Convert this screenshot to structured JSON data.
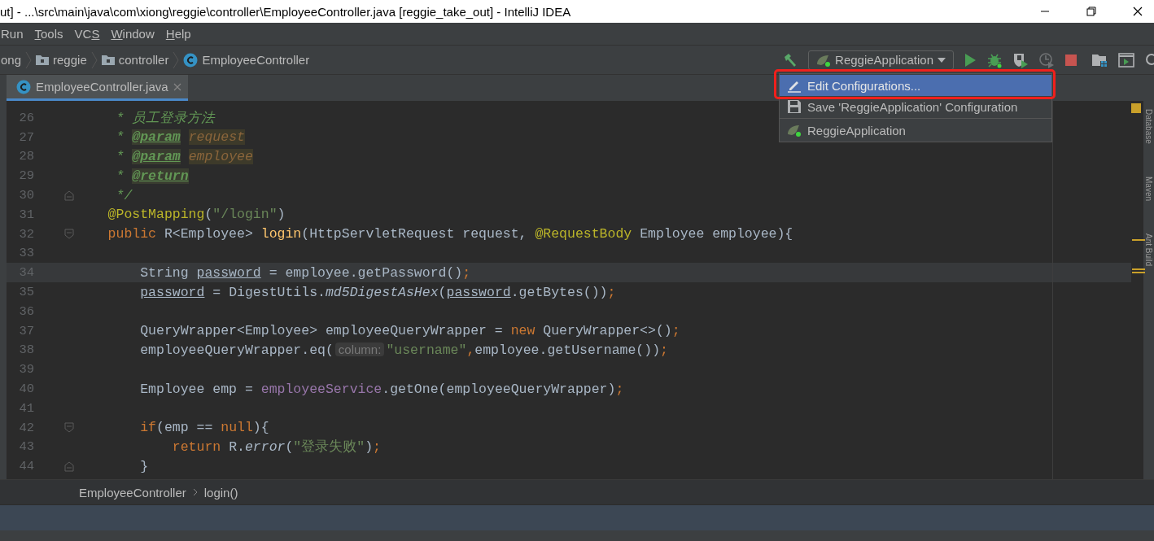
{
  "window": {
    "title": "ut] - ...\\src\\main\\java\\com\\xiong\\reggie\\controller\\EmployeeController.java [reggie_take_out] - IntelliJ IDEA"
  },
  "menu": [
    {
      "parts": [
        {
          "text": "Run",
          "underlined": false
        }
      ]
    },
    {
      "parts": [
        {
          "text": "T",
          "underlined": true
        },
        {
          "text": "ools",
          "underlined": false
        }
      ]
    },
    {
      "parts": [
        {
          "text": "VC",
          "underlined": false
        },
        {
          "text": "S",
          "underlined": true
        }
      ]
    },
    {
      "parts": [
        {
          "text": "W",
          "underlined": true
        },
        {
          "text": "indow",
          "underlined": false
        }
      ]
    },
    {
      "parts": [
        {
          "text": "H",
          "underlined": true
        },
        {
          "text": "elp",
          "underlined": false
        }
      ]
    }
  ],
  "breadcrumbs": [
    {
      "label": "ong",
      "kind": "text"
    },
    {
      "label": "reggie",
      "kind": "folder"
    },
    {
      "label": "controller",
      "kind": "folder"
    },
    {
      "label": "EmployeeController",
      "kind": "class"
    }
  ],
  "run_config": {
    "label": "ReggieApplication"
  },
  "toolbar": [
    {
      "kind": "run",
      "disabled": false
    },
    {
      "kind": "debug",
      "disabled": false
    },
    {
      "kind": "coverage",
      "disabled": false
    },
    {
      "kind": "profile",
      "disabled": true
    },
    {
      "kind": "stop",
      "disabled": false
    },
    {
      "kind": "structure",
      "disabled": false
    },
    {
      "kind": "terminal",
      "disabled": false
    },
    {
      "kind": "search",
      "disabled": false
    }
  ],
  "dropdown": [
    {
      "label": "Edit Configurations...",
      "kind": "edit",
      "selected": true
    },
    {
      "label": "Save 'ReggieApplication' Configuration",
      "kind": "save",
      "selected": false
    },
    {
      "label": "ReggieApplication",
      "kind": "app",
      "selected": false
    }
  ],
  "tabs": [
    {
      "label": "EmployeeController.java",
      "selected": true
    }
  ],
  "editor": {
    "lines": [
      {
        "number": "26",
        "current": false,
        "kind": "doc",
        "tokens": [
          {
            "kind": "doc",
            "text": "* 员工登录方法"
          }
        ]
      },
      {
        "number": "27",
        "current": false,
        "kind": "doc",
        "tokens": [
          {
            "kind": "doc",
            "text": "* "
          },
          {
            "kind": "doctag",
            "text": "@param"
          },
          {
            "kind": "docparam",
            "text": "request"
          }
        ]
      },
      {
        "number": "28",
        "current": false,
        "kind": "doc",
        "tokens": [
          {
            "kind": "doc",
            "text": "* "
          },
          {
            "kind": "doctag",
            "text": "@param"
          },
          {
            "kind": "docparam",
            "text": "employee"
          }
        ]
      },
      {
        "number": "29",
        "current": false,
        "kind": "doc",
        "tokens": [
          {
            "kind": "doc",
            "text": "* "
          },
          {
            "kind": "doctag",
            "text": "@return"
          }
        ]
      },
      {
        "number": "30",
        "current": false,
        "kind": "doc_fold_end",
        "tokens": [
          {
            "kind": "doc",
            "text": "*/"
          }
        ]
      },
      {
        "number": "31",
        "current": false,
        "kind": "member",
        "tokens": [
          {
            "kind": "annotation",
            "text": "@PostMapping"
          },
          {
            "kind": "plain",
            "text": "("
          },
          {
            "kind": "string",
            "text": "\"/login\""
          },
          {
            "kind": "plain",
            "text": ")"
          }
        ]
      },
      {
        "number": "32",
        "current": false,
        "kind": "member_fold_start",
        "tokens": [
          {
            "kind": "keyword",
            "text": "public "
          },
          {
            "kind": "plain",
            "text": "R<Employee> "
          },
          {
            "kind": "decl",
            "text": "login"
          },
          {
            "kind": "plain",
            "text": "(HttpServletRequest request, "
          },
          {
            "kind": "annotation",
            "text": "@RequestBody"
          },
          {
            "kind": "plain",
            "text": " Employee employee){"
          }
        ]
      },
      {
        "number": "33",
        "current": false,
        "kind": "blank"
      },
      {
        "number": "34",
        "current": true,
        "kind": "body",
        "tokens": [
          {
            "kind": "plain",
            "text": "String "
          },
          {
            "kind": "underline",
            "text": "password"
          },
          {
            "kind": "plain",
            "text": " = employee.getPassword()"
          },
          {
            "kind": "keyword",
            "text": ";"
          }
        ]
      },
      {
        "number": "35",
        "current": false,
        "kind": "body",
        "tokens": [
          {
            "kind": "underline",
            "text": "password"
          },
          {
            "kind": "plain",
            "text": " = DigestUtils."
          },
          {
            "kind": "italic",
            "text": "md5DigestAsHex"
          },
          {
            "kind": "plain",
            "text": "("
          },
          {
            "kind": "underline",
            "text": "password"
          },
          {
            "kind": "plain",
            "text": ".getBytes())"
          },
          {
            "kind": "keyword",
            "text": ";"
          }
        ]
      },
      {
        "number": "36",
        "current": false,
        "kind": "blank"
      },
      {
        "number": "37",
        "current": false,
        "kind": "body",
        "tokens": [
          {
            "kind": "plain",
            "text": "QueryWrapper<Employee> employeeQueryWrapper = "
          },
          {
            "kind": "keyword",
            "text": "new "
          },
          {
            "kind": "plain",
            "text": "QueryWrapper<>()"
          },
          {
            "kind": "keyword",
            "text": ";"
          }
        ]
      },
      {
        "number": "38",
        "current": false,
        "kind": "body",
        "tokens": [
          {
            "kind": "plain",
            "text": "employeeQueryWrapper.eq("
          },
          {
            "kind": "hint",
            "text": "column:"
          },
          {
            "kind": "string",
            "text": "\"username\""
          },
          {
            "kind": "keyword",
            "text": ","
          },
          {
            "kind": "plain",
            "text": "employee.getUsername())"
          },
          {
            "kind": "keyword",
            "text": ";"
          }
        ]
      },
      {
        "number": "39",
        "current": false,
        "kind": "blank"
      },
      {
        "number": "40",
        "current": false,
        "kind": "body",
        "tokens": [
          {
            "kind": "plain",
            "text": "Employee emp = "
          },
          {
            "kind": "field",
            "text": "employeeService"
          },
          {
            "kind": "plain",
            "text": ".getOne(employeeQueryWrapper)"
          },
          {
            "kind": "keyword",
            "text": ";"
          }
        ]
      },
      {
        "number": "41",
        "current": false,
        "kind": "blank"
      },
      {
        "number": "42",
        "current": false,
        "kind": "body_fold_start",
        "tokens": [
          {
            "kind": "keyword",
            "text": "if"
          },
          {
            "kind": "plain",
            "text": "(emp == "
          },
          {
            "kind": "keyword",
            "text": "null"
          },
          {
            "kind": "plain",
            "text": "){"
          }
        ]
      },
      {
        "number": "43",
        "current": false,
        "kind": "nested",
        "tokens": [
          {
            "kind": "keyword",
            "text": "return "
          },
          {
            "kind": "plain",
            "text": "R."
          },
          {
            "kind": "italic",
            "text": "error"
          },
          {
            "kind": "plain",
            "text": "("
          },
          {
            "kind": "string",
            "text": "\"登录失败\""
          },
          {
            "kind": "plain",
            "text": ")"
          },
          {
            "kind": "keyword",
            "text": ";"
          }
        ]
      },
      {
        "number": "44",
        "current": false,
        "kind": "body_fold_end",
        "tokens": [
          {
            "kind": "plain",
            "text": "}"
          }
        ]
      }
    ]
  },
  "code_breadcrumbs": [
    "EmployeeController",
    "login()"
  ],
  "tool_strip": [
    "Database",
    "Maven",
    "Ant Build"
  ]
}
